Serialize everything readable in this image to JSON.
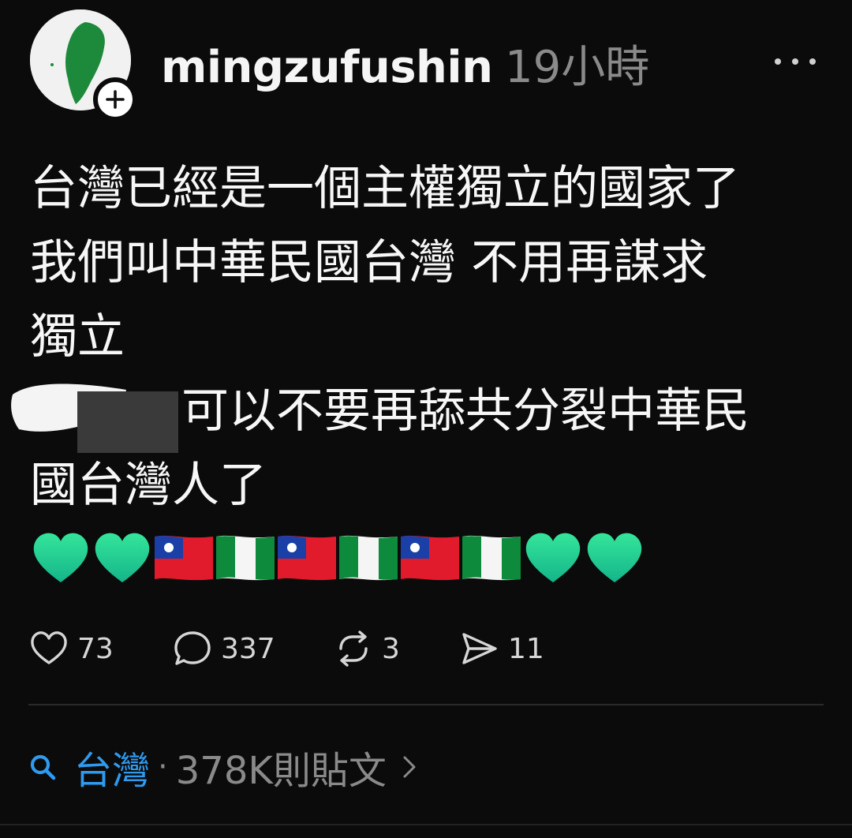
{
  "post": {
    "username": "mingzufushin",
    "timestamp": "19小時",
    "body_lines": [
      "台灣已經是一個主權獨立的國家了",
      "我們叫中華民國台灣 不用再謀求",
      "獨立",
      "可以不要再舔共分裂中華民",
      "國台灣人了"
    ],
    "emoji_icons": [
      "green-heart",
      "green-heart",
      "roc-flag",
      "green-white-green-flag",
      "roc-flag",
      "green-white-green-flag",
      "roc-flag",
      "green-white-green-flag",
      "green-heart",
      "green-heart"
    ]
  },
  "actions": {
    "likes": "73",
    "replies": "337",
    "reposts": "3",
    "shares": "11"
  },
  "topic": {
    "name": "台灣",
    "separator": "·",
    "count": "378K則貼文"
  },
  "colors": {
    "background": "#0b0b0b",
    "text": "#f7f7f7",
    "muted": "#8a8a8a",
    "link": "#2f9bf0",
    "heart_green": "#1fd28a",
    "flag_red": "#e21b2c",
    "flag_blue": "#1a3fa6",
    "flag_green": "#0e8a3c"
  }
}
